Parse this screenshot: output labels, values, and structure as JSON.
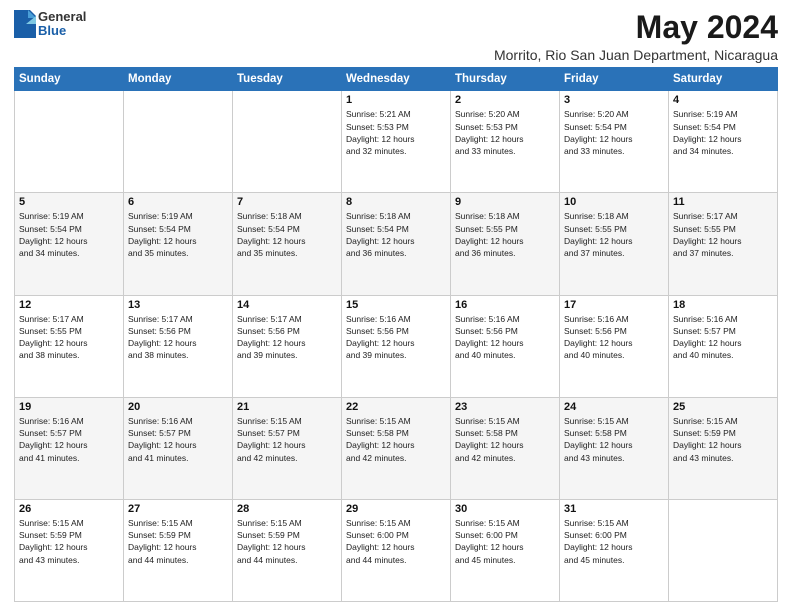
{
  "header": {
    "logo_general": "General",
    "logo_blue": "Blue",
    "month_year": "May 2024",
    "location": "Morrito, Rio San Juan Department, Nicaragua"
  },
  "days_of_week": [
    "Sunday",
    "Monday",
    "Tuesday",
    "Wednesday",
    "Thursday",
    "Friday",
    "Saturday"
  ],
  "weeks": [
    [
      {
        "day": "",
        "info": ""
      },
      {
        "day": "",
        "info": ""
      },
      {
        "day": "",
        "info": ""
      },
      {
        "day": "1",
        "info": "Sunrise: 5:21 AM\nSunset: 5:53 PM\nDaylight: 12 hours\nand 32 minutes."
      },
      {
        "day": "2",
        "info": "Sunrise: 5:20 AM\nSunset: 5:53 PM\nDaylight: 12 hours\nand 33 minutes."
      },
      {
        "day": "3",
        "info": "Sunrise: 5:20 AM\nSunset: 5:54 PM\nDaylight: 12 hours\nand 33 minutes."
      },
      {
        "day": "4",
        "info": "Sunrise: 5:19 AM\nSunset: 5:54 PM\nDaylight: 12 hours\nand 34 minutes."
      }
    ],
    [
      {
        "day": "5",
        "info": "Sunrise: 5:19 AM\nSunset: 5:54 PM\nDaylight: 12 hours\nand 34 minutes."
      },
      {
        "day": "6",
        "info": "Sunrise: 5:19 AM\nSunset: 5:54 PM\nDaylight: 12 hours\nand 35 minutes."
      },
      {
        "day": "7",
        "info": "Sunrise: 5:18 AM\nSunset: 5:54 PM\nDaylight: 12 hours\nand 35 minutes."
      },
      {
        "day": "8",
        "info": "Sunrise: 5:18 AM\nSunset: 5:54 PM\nDaylight: 12 hours\nand 36 minutes."
      },
      {
        "day": "9",
        "info": "Sunrise: 5:18 AM\nSunset: 5:55 PM\nDaylight: 12 hours\nand 36 minutes."
      },
      {
        "day": "10",
        "info": "Sunrise: 5:18 AM\nSunset: 5:55 PM\nDaylight: 12 hours\nand 37 minutes."
      },
      {
        "day": "11",
        "info": "Sunrise: 5:17 AM\nSunset: 5:55 PM\nDaylight: 12 hours\nand 37 minutes."
      }
    ],
    [
      {
        "day": "12",
        "info": "Sunrise: 5:17 AM\nSunset: 5:55 PM\nDaylight: 12 hours\nand 38 minutes."
      },
      {
        "day": "13",
        "info": "Sunrise: 5:17 AM\nSunset: 5:56 PM\nDaylight: 12 hours\nand 38 minutes."
      },
      {
        "day": "14",
        "info": "Sunrise: 5:17 AM\nSunset: 5:56 PM\nDaylight: 12 hours\nand 39 minutes."
      },
      {
        "day": "15",
        "info": "Sunrise: 5:16 AM\nSunset: 5:56 PM\nDaylight: 12 hours\nand 39 minutes."
      },
      {
        "day": "16",
        "info": "Sunrise: 5:16 AM\nSunset: 5:56 PM\nDaylight: 12 hours\nand 40 minutes."
      },
      {
        "day": "17",
        "info": "Sunrise: 5:16 AM\nSunset: 5:56 PM\nDaylight: 12 hours\nand 40 minutes."
      },
      {
        "day": "18",
        "info": "Sunrise: 5:16 AM\nSunset: 5:57 PM\nDaylight: 12 hours\nand 40 minutes."
      }
    ],
    [
      {
        "day": "19",
        "info": "Sunrise: 5:16 AM\nSunset: 5:57 PM\nDaylight: 12 hours\nand 41 minutes."
      },
      {
        "day": "20",
        "info": "Sunrise: 5:16 AM\nSunset: 5:57 PM\nDaylight: 12 hours\nand 41 minutes."
      },
      {
        "day": "21",
        "info": "Sunrise: 5:15 AM\nSunset: 5:57 PM\nDaylight: 12 hours\nand 42 minutes."
      },
      {
        "day": "22",
        "info": "Sunrise: 5:15 AM\nSunset: 5:58 PM\nDaylight: 12 hours\nand 42 minutes."
      },
      {
        "day": "23",
        "info": "Sunrise: 5:15 AM\nSunset: 5:58 PM\nDaylight: 12 hours\nand 42 minutes."
      },
      {
        "day": "24",
        "info": "Sunrise: 5:15 AM\nSunset: 5:58 PM\nDaylight: 12 hours\nand 43 minutes."
      },
      {
        "day": "25",
        "info": "Sunrise: 5:15 AM\nSunset: 5:59 PM\nDaylight: 12 hours\nand 43 minutes."
      }
    ],
    [
      {
        "day": "26",
        "info": "Sunrise: 5:15 AM\nSunset: 5:59 PM\nDaylight: 12 hours\nand 43 minutes."
      },
      {
        "day": "27",
        "info": "Sunrise: 5:15 AM\nSunset: 5:59 PM\nDaylight: 12 hours\nand 44 minutes."
      },
      {
        "day": "28",
        "info": "Sunrise: 5:15 AM\nSunset: 5:59 PM\nDaylight: 12 hours\nand 44 minutes."
      },
      {
        "day": "29",
        "info": "Sunrise: 5:15 AM\nSunset: 6:00 PM\nDaylight: 12 hours\nand 44 minutes."
      },
      {
        "day": "30",
        "info": "Sunrise: 5:15 AM\nSunset: 6:00 PM\nDaylight: 12 hours\nand 45 minutes."
      },
      {
        "day": "31",
        "info": "Sunrise: 5:15 AM\nSunset: 6:00 PM\nDaylight: 12 hours\nand 45 minutes."
      },
      {
        "day": "",
        "info": ""
      }
    ]
  ]
}
